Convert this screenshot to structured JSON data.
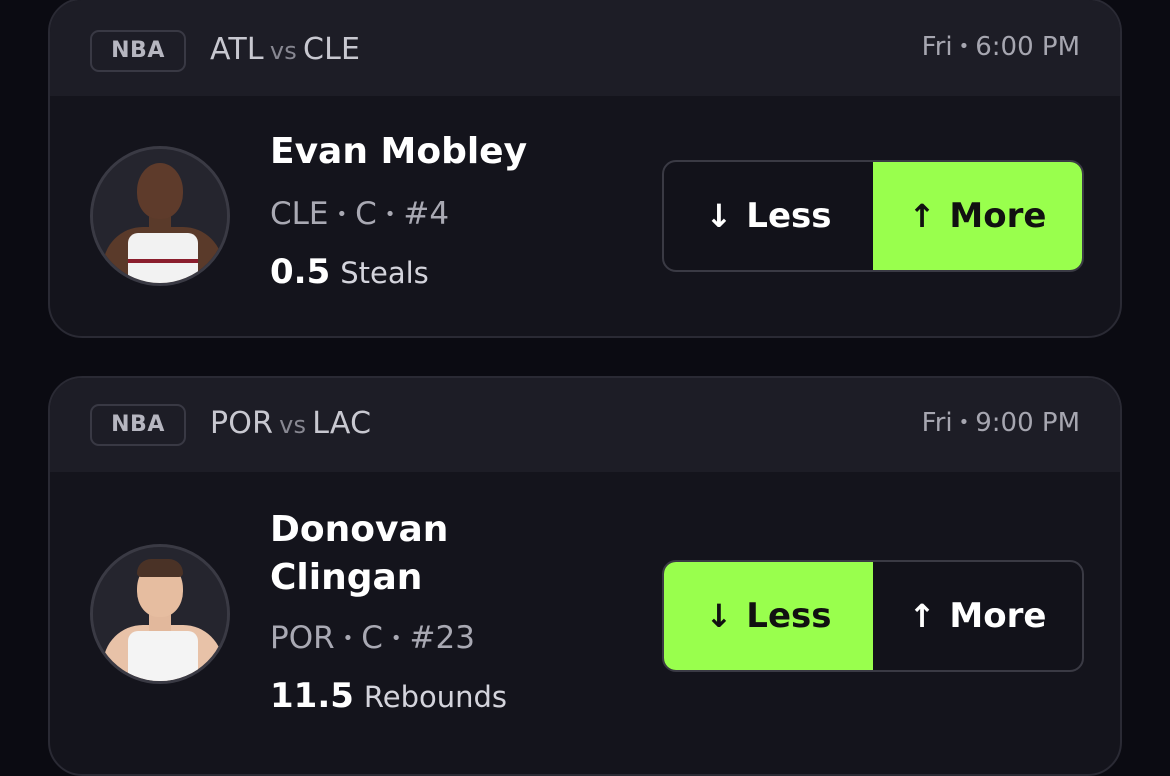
{
  "cards": [
    {
      "league": "NBA",
      "team_a": "ATL",
      "vs": "vs",
      "team_b": "CLE",
      "day": "Fri",
      "time": "6:00 PM",
      "player_name": "Evan Mobley",
      "team": "CLE",
      "position": "C",
      "number": "#4",
      "line_value": "0.5",
      "stat": "Steals",
      "less_label": "Less",
      "more_label": "More",
      "selected": "more"
    },
    {
      "league": "NBA",
      "team_a": "POR",
      "vs": "vs",
      "team_b": "LAC",
      "day": "Fri",
      "time": "9:00 PM",
      "player_name": "Donovan Clingan",
      "team": "POR",
      "position": "C",
      "number": "#23",
      "line_value": "11.5",
      "stat": "Rebounds",
      "less_label": "Less",
      "more_label": "More",
      "selected": "less"
    }
  ],
  "colors": {
    "background": "#0b0b12",
    "card": "#14141c",
    "header": "#1d1d26",
    "accent_selected": "#99ff4d"
  },
  "icons": {
    "less": "arrow-down-icon",
    "more": "arrow-up-icon"
  }
}
